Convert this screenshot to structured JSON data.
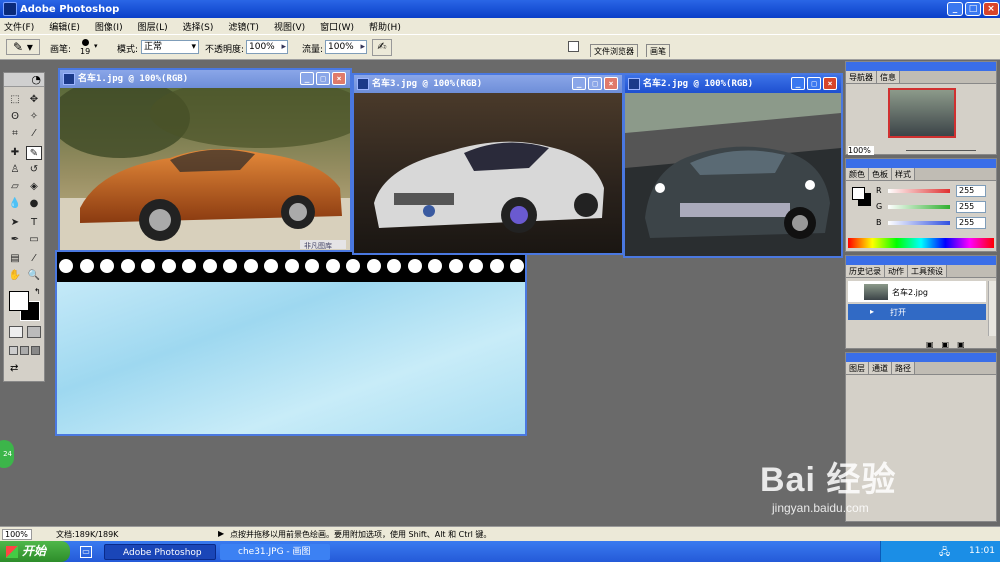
{
  "window": {
    "title": "Adobe Photoshop"
  },
  "menu": [
    "文件(F)",
    "编辑(E)",
    "图像(I)",
    "图层(L)",
    "选择(S)",
    "滤镜(T)",
    "视图(V)",
    "窗口(W)",
    "帮助(H)"
  ],
  "options": {
    "brush_label": "画笔:",
    "brush_size": "19",
    "mode_label": "模式:",
    "mode_value": "正常",
    "opacity_label": "不透明度:",
    "opacity_value": "100%",
    "flow_label": "流量:",
    "flow_value": "100%",
    "tab_file_browser": "文件浏览器",
    "tab_brushes": "画笔"
  },
  "documents": [
    {
      "title": "名车1.jpg @ 100%(RGB)",
      "watermark": "非凡图库"
    },
    {
      "title": "名车3.jpg @ 100%(RGB)"
    },
    {
      "title": "名车2.jpg @ 100%(RGB)"
    }
  ],
  "navigator": {
    "tabs": [
      "导航器",
      "信息"
    ],
    "zoom": "100%"
  },
  "color_panel": {
    "tabs": [
      "颜色",
      "色板",
      "样式"
    ],
    "channels": [
      {
        "name": "R",
        "value": "255",
        "color": "#e03030"
      },
      {
        "name": "G",
        "value": "255",
        "color": "#30b030"
      },
      {
        "name": "B",
        "value": "255",
        "color": "#3050e0"
      }
    ]
  },
  "history_panel": {
    "tabs": [
      "历史记录",
      "动作",
      "工具预设"
    ],
    "snapshot": "名车2.jpg",
    "items": [
      "打开"
    ]
  },
  "layers_panel": {
    "tabs": [
      "图层",
      "通道",
      "路径"
    ]
  },
  "status": {
    "zoom": "100%",
    "doc": "文档:189K/189K",
    "hint": "点按并拖移以用前景色绘画。要用附加选项，使用 Shift、Alt 和 Ctrl 键。"
  },
  "badge": "24",
  "taskbar": {
    "start": "开始",
    "tasks": [
      "Adobe Photoshop",
      "che31.JPG - 画图"
    ],
    "time": "11:01"
  },
  "watermark": {
    "brand": "Bai  经验",
    "url": "jingyan.baidu.com"
  }
}
